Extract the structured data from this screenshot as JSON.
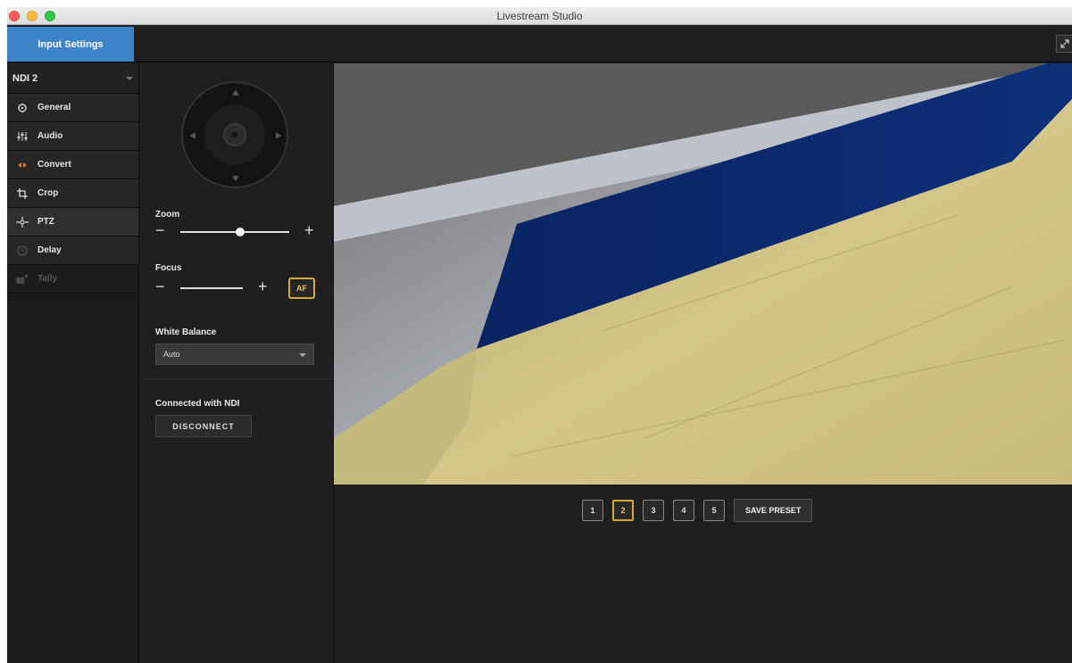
{
  "window": {
    "title": "Livestream Studio"
  },
  "toolbar": {
    "tab_label": "Input Settings"
  },
  "sidebar": {
    "source": "NDI 2",
    "items": [
      {
        "label": "General",
        "icon": "gear-icon"
      },
      {
        "label": "Audio",
        "icon": "audio-levels-icon"
      },
      {
        "label": "Convert",
        "icon": "convert-icon"
      },
      {
        "label": "Crop",
        "icon": "crop-icon"
      },
      {
        "label": "PTZ",
        "icon": "ptz-icon"
      },
      {
        "label": "Delay",
        "icon": "clock-icon"
      },
      {
        "label": "Tally",
        "icon": "tally-icon"
      }
    ]
  },
  "ptz": {
    "zoom_label": "Zoom",
    "zoom_level": 0.55,
    "focus_label": "Focus",
    "af_label": "AF",
    "white_balance_label": "White Balance",
    "white_balance_value": "Auto",
    "connection_label": "Connected with NDI",
    "disconnect_label": "DISCONNECT",
    "minus_symbol": "−",
    "plus_symbol": "+"
  },
  "presets": {
    "buttons": [
      "1",
      "2",
      "3",
      "4",
      "5"
    ],
    "selected": "2",
    "save_label": "SAVE PRESET"
  },
  "colors": {
    "accent_blue": "#3d83c8",
    "selected_gold": "#d4a93b",
    "flag_blue": "#0b2a6e",
    "flag_yellow": "#cfc285"
  }
}
